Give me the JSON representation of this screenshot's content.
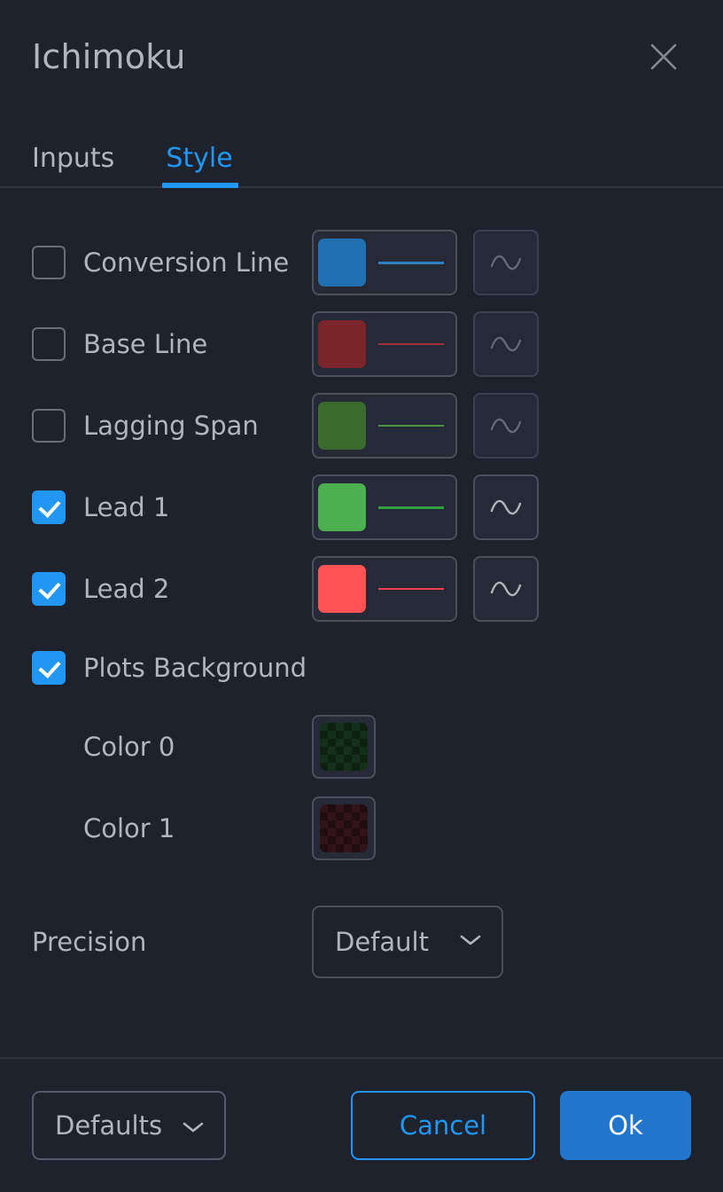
{
  "dialog": {
    "title": "Ichimoku",
    "close_icon": "close-icon"
  },
  "tabs": [
    {
      "label": "Inputs",
      "active": false
    },
    {
      "label": "Style",
      "active": true
    }
  ],
  "style_rows": [
    {
      "label": "Conversion Line",
      "checked": false,
      "swatch_color": "#2271b3",
      "line_color": "#2f7fc4",
      "line_width": 3,
      "wave_icon": "wave-line-icon",
      "wave_dim": true
    },
    {
      "label": "Base Line",
      "checked": false,
      "swatch_color": "#7a2529",
      "line_color": "#a2323a",
      "line_width": 2,
      "wave_icon": "wave-line-icon",
      "wave_dim": true
    },
    {
      "label": "Lagging Span",
      "checked": false,
      "swatch_color": "#3a6b2e",
      "line_color": "#4e9040",
      "line_width": 2,
      "wave_icon": "wave-line-icon",
      "wave_dim": true
    },
    {
      "label": "Lead 1",
      "checked": true,
      "swatch_color": "#4caf50",
      "line_color": "#2e9e3f",
      "line_width": 3,
      "wave_icon": "wave-line-icon",
      "wave_dim": false
    },
    {
      "label": "Lead 2",
      "checked": true,
      "swatch_color": "#ff5252",
      "line_color": "#f1414b",
      "line_width": 2,
      "wave_icon": "wave-line-icon",
      "wave_dim": false
    }
  ],
  "plots_background": {
    "label": "Plots Background",
    "checked": true,
    "colors": [
      {
        "label": "Color 0",
        "color_a": "#0d2111",
        "color_b": "#14301a",
        "tint": "green"
      },
      {
        "label": "Color 1",
        "color_a": "#210d10",
        "color_b": "#301419",
        "tint": "red"
      }
    ]
  },
  "precision": {
    "label": "Precision",
    "value": "Default",
    "chevron_icon": "chevron-down-icon"
  },
  "footer": {
    "defaults_label": "Defaults",
    "defaults_chevron": "chevron-down-icon",
    "cancel_label": "Cancel",
    "ok_label": "Ok"
  },
  "theme": {
    "background": "#1e222d",
    "accent": "#2196f3",
    "ok_button": "#2176cc",
    "text": "#b2b5be",
    "border": "#4a4f5c",
    "divider": "#2f3340"
  }
}
